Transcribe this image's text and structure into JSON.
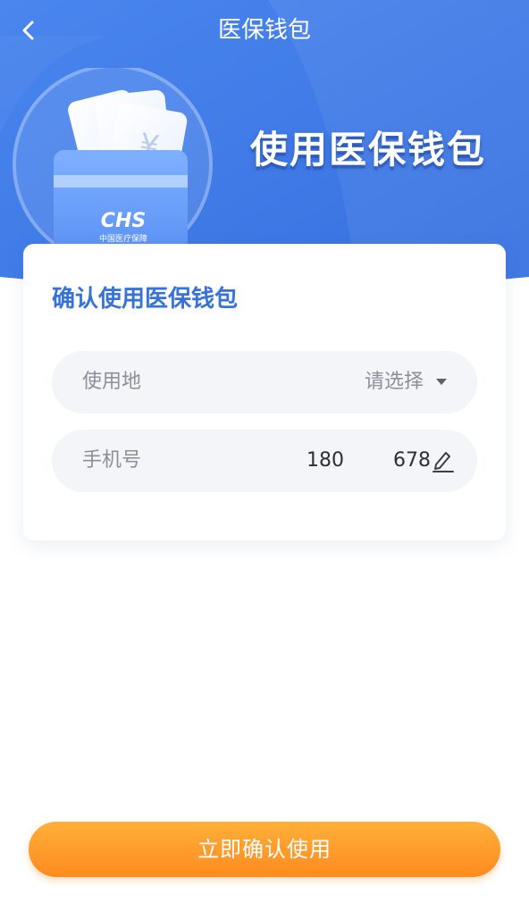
{
  "nav": {
    "title": "医保钱包",
    "back_icon": "chevron-left-icon"
  },
  "hero": {
    "title": "使用医保钱包",
    "illustration": "wallet-cards-icon",
    "logo_text": "CHS",
    "logo_subtext": "中国医疗保障",
    "card_symbol": "¥"
  },
  "card": {
    "title": "确认使用医保钱包",
    "location": {
      "label": "使用地",
      "value": "请选择",
      "icon": "caret-down-icon"
    },
    "phone": {
      "label": "手机号",
      "value": "180",
      "value_suffix": "678",
      "icon": "edit-icon"
    }
  },
  "footer": {
    "confirm_label": "立即确认使用"
  },
  "colors": {
    "hero_blue": "#3d7ae6",
    "hero_blue_light": "#4f8cf0",
    "card_title_blue": "#3772d9",
    "field_bg": "#f4f5f9",
    "button_orange_top": "#ffb03a",
    "button_orange_bottom": "#ff8a1e"
  }
}
